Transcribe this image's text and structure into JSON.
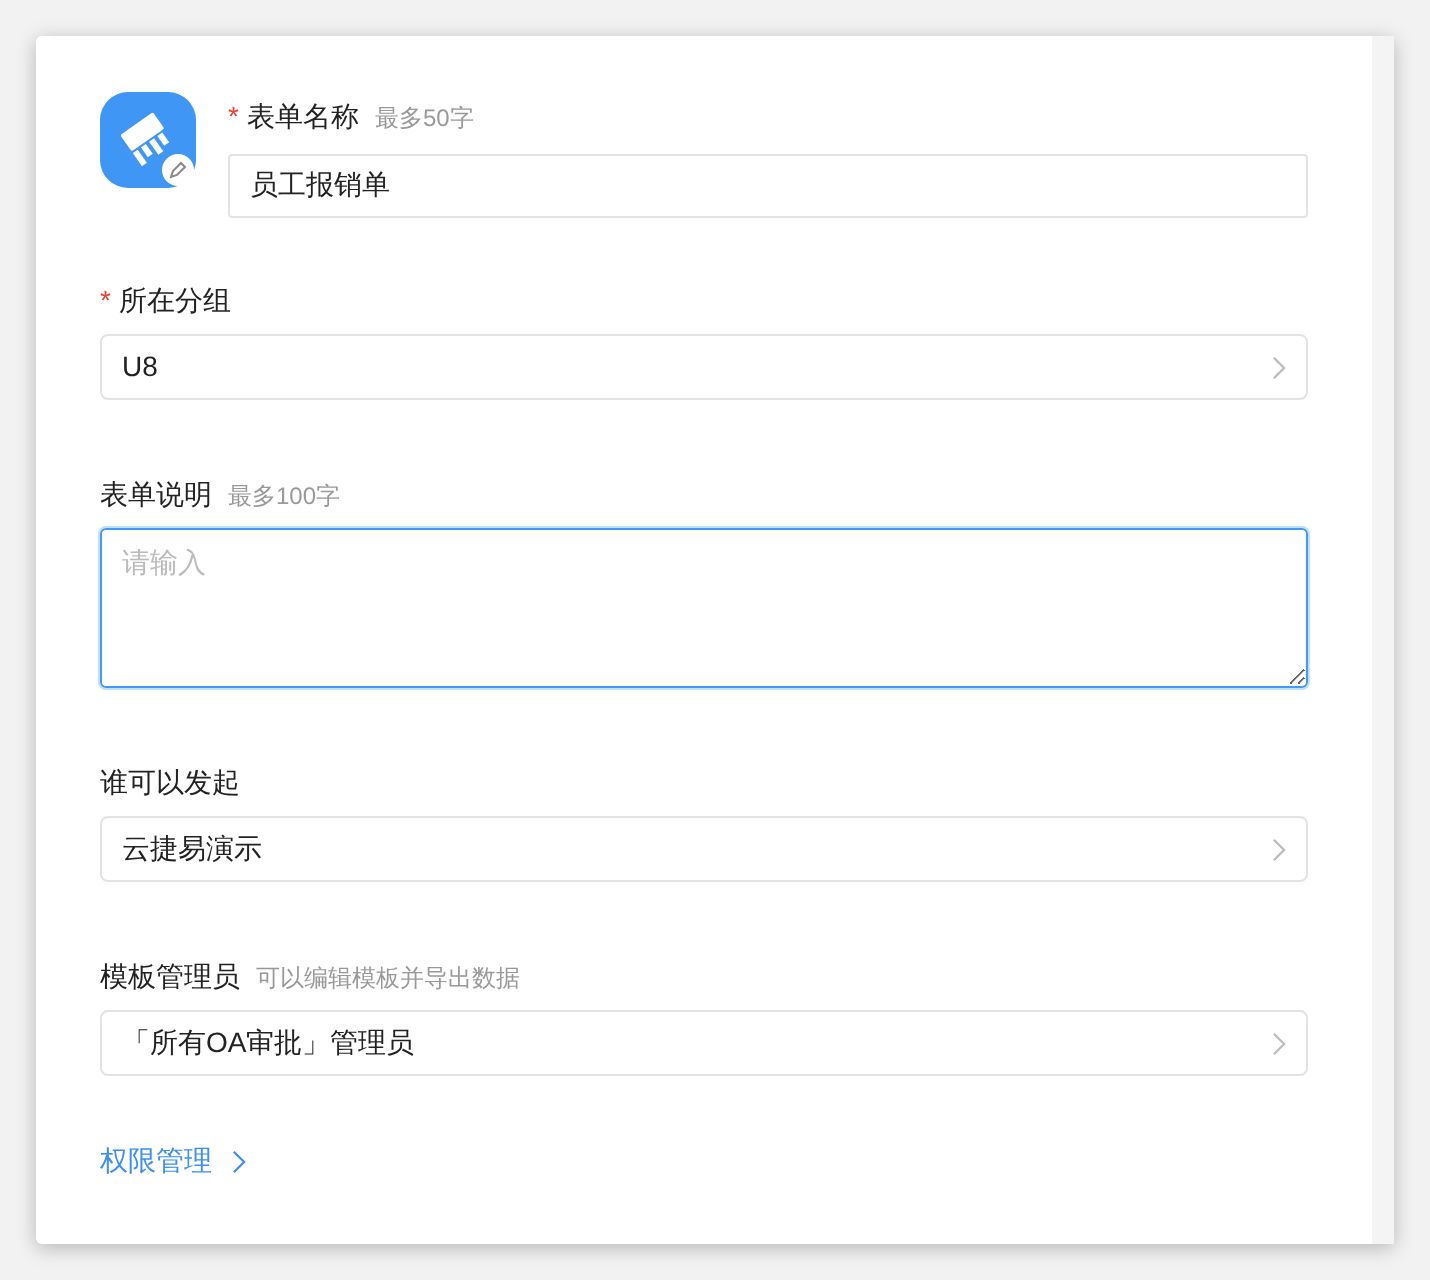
{
  "form_name": {
    "label": "表单名称",
    "required_mark": "*",
    "hint": "最多50字",
    "value": "员工报销单"
  },
  "fields": [
    {
      "kind": "select",
      "label": "所在分组",
      "required_mark": "*",
      "value": "U8"
    },
    {
      "kind": "textarea",
      "label": "表单说明",
      "hint": "最多100字",
      "placeholder": "请输入",
      "focused": true
    },
    {
      "kind": "select",
      "label": "谁可以发起",
      "value": "云捷易演示"
    },
    {
      "kind": "select",
      "label": "模板管理员",
      "hint": "可以编辑模板并导出数据",
      "value": "「所有OA审批」管理员"
    }
  ],
  "link": {
    "label": "权限管理"
  }
}
